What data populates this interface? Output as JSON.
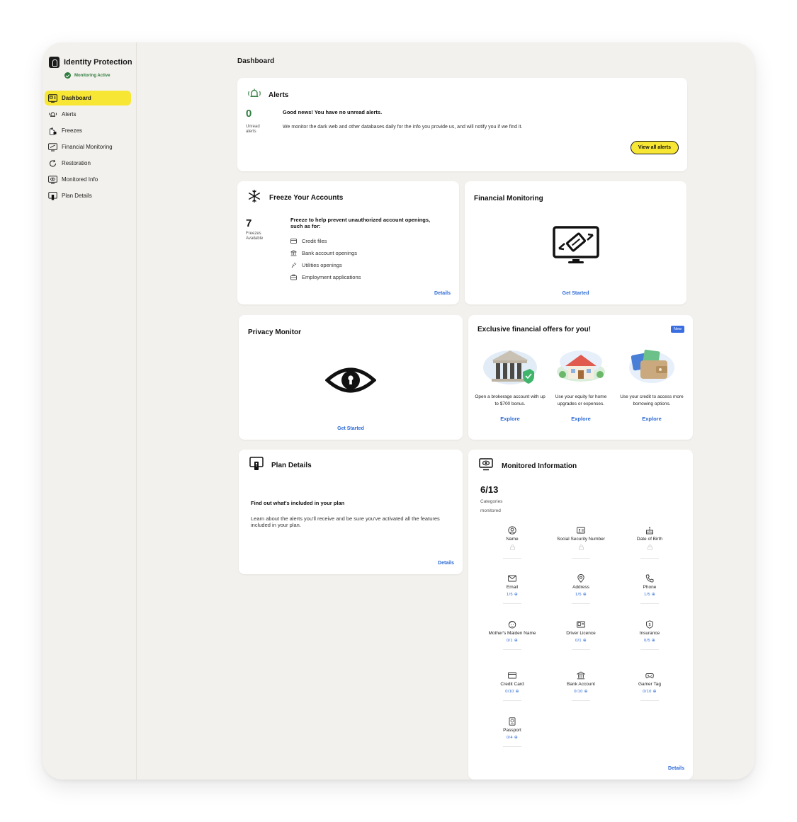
{
  "sidebar": {
    "brand": "Identity Protection",
    "status": "Monitoring Active",
    "items": [
      {
        "label": "Dashboard"
      },
      {
        "label": "Alerts"
      },
      {
        "label": "Freezes"
      },
      {
        "label": "Financial Monitoring"
      },
      {
        "label": "Restoration"
      },
      {
        "label": "Monitored Info"
      },
      {
        "label": "Plan Details"
      }
    ]
  },
  "page": {
    "title": "Dashboard"
  },
  "alerts": {
    "title": "Alerts",
    "count": "0",
    "count_label": "Unread alerts",
    "headline": "Good news! You have no unread alerts.",
    "body": "We monitor the dark web and other databases daily for the info you provide us, and will notify you if we find it.",
    "button": "View all alerts"
  },
  "freeze": {
    "title": "Freeze Your Accounts",
    "count": "7",
    "count_label": "Freezes Available",
    "intro": "Freeze to help prevent unauthorized account openings, such as for:",
    "items": [
      "Credit files",
      "Bank account openings",
      "Utilities openings",
      "Employment applications"
    ],
    "link": "Details"
  },
  "financial_monitoring": {
    "title": "Financial Monitoring",
    "link": "Get Started"
  },
  "privacy": {
    "title": "Privacy Monitor",
    "link": "Get Started"
  },
  "offers": {
    "title": "Exclusive financial offers for you!",
    "badge": "New",
    "items": [
      {
        "text": "Open a brokerage account with up to $700 bonus.",
        "link": "Explore"
      },
      {
        "text": "Use your equity for home upgrades or expenses.",
        "link": "Explore"
      },
      {
        "text": "Use your credit to access more borrowing options.",
        "link": "Explore"
      }
    ]
  },
  "plan": {
    "title": "Plan Details",
    "headline": "Find out what's included in your plan",
    "body": "Learn about the alerts you'll receive and be sure you've activated all the features included in your plan.",
    "link": "Details"
  },
  "monitored": {
    "title": "Monitored Information",
    "count": "6/13",
    "count_label_1": "Categories",
    "count_label_2": "monitored",
    "categories": [
      {
        "name": "Name",
        "count": "",
        "icon": "user-icon"
      },
      {
        "name": "Social Security Number",
        "count": "",
        "icon": "id-card-icon"
      },
      {
        "name": "Date of Birth",
        "count": "",
        "icon": "cake-icon"
      },
      {
        "name": "Email",
        "count": "1/5",
        "icon": "mail-icon"
      },
      {
        "name": "Address",
        "count": "1/5",
        "icon": "pin-icon"
      },
      {
        "name": "Phone",
        "count": "1/5",
        "icon": "phone-icon"
      },
      {
        "name": "Mother's Maiden Name",
        "count": "0/1",
        "icon": "face-icon"
      },
      {
        "name": "Driver Licence",
        "count": "0/1",
        "icon": "license-icon"
      },
      {
        "name": "Insurance",
        "count": "0/5",
        "icon": "shield-icon"
      },
      {
        "name": "Credit Card",
        "count": "0/10",
        "icon": "credit-card-icon"
      },
      {
        "name": "Bank Account",
        "count": "0/10",
        "icon": "bank-icon"
      },
      {
        "name": "Gamer Tag",
        "count": "0/10",
        "icon": "gamepad-icon"
      },
      {
        "name": "Passport",
        "count": "0/4",
        "icon": "passport-icon"
      }
    ],
    "link": "Details"
  }
}
